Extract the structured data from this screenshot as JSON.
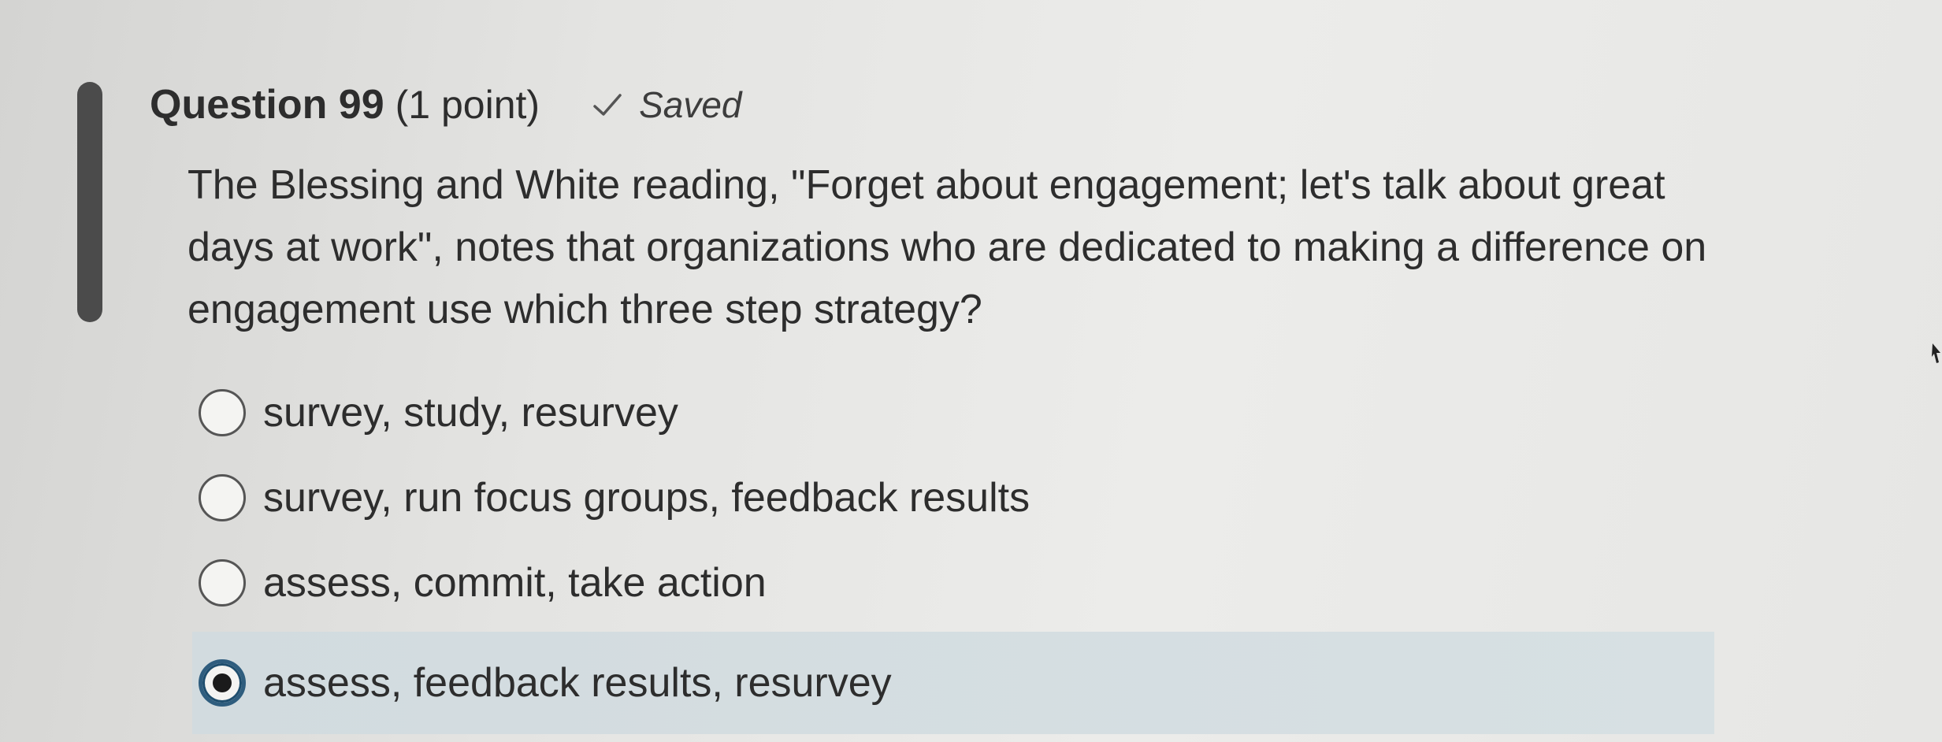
{
  "question": {
    "title": "Question 99",
    "points": "(1 point)",
    "status": "Saved",
    "text": "The Blessing and White reading, \"Forget about engagement; let's talk about great days at work\", notes that organizations who are dedicated to making a difference on engagement use which three step strategy?"
  },
  "options": [
    {
      "label": "survey, study, resurvey",
      "selected": false
    },
    {
      "label": "survey, run focus groups, feedback results",
      "selected": false
    },
    {
      "label": "assess, commit, take action",
      "selected": false
    },
    {
      "label": "assess, feedback results, resurvey",
      "selected": true
    }
  ],
  "icons": {
    "status": "check-icon"
  },
  "colors": {
    "selected_background": "#d2dbdf",
    "radio_checked_ring": "#2f5d7e",
    "text": "#2d2d2d"
  }
}
